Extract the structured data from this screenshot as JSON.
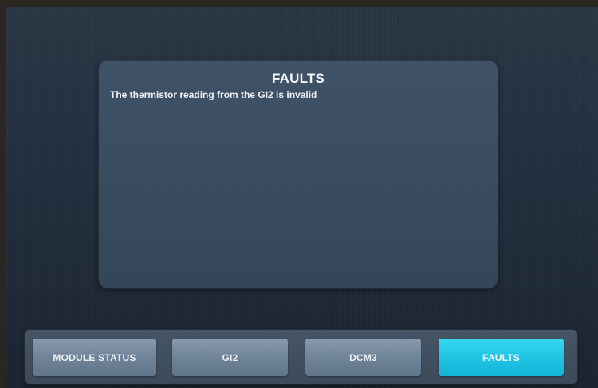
{
  "panel": {
    "title": "FAULTS",
    "faults": [
      "The thermistor reading from the GI2 is invalid"
    ]
  },
  "tabs": [
    {
      "label": "MODULE STATUS",
      "active": false
    },
    {
      "label": "GI2",
      "active": false
    },
    {
      "label": "DCM3",
      "active": false
    },
    {
      "label": "FAULTS",
      "active": true
    }
  ],
  "colors": {
    "background": "#1f2a37",
    "panel": "#3a4c60",
    "tab": "#6e8297",
    "tab_active": "#1fc3e2",
    "text": "#f4f7fa"
  }
}
